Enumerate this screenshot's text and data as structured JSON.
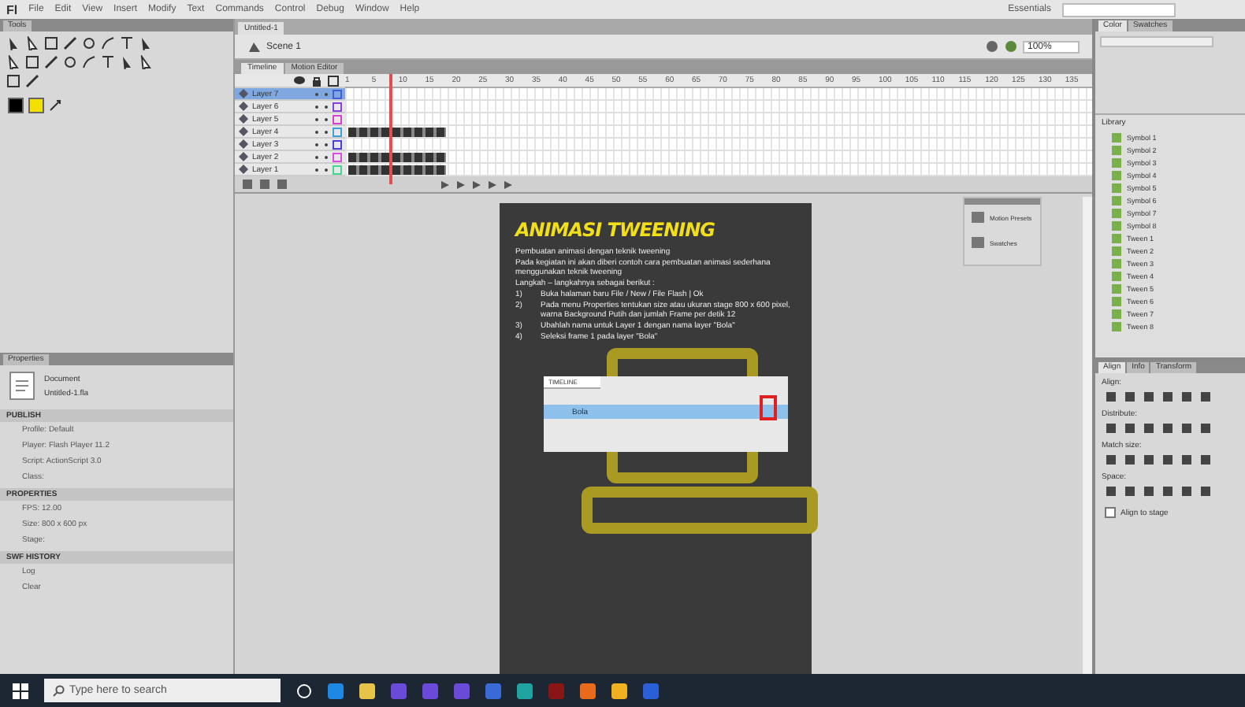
{
  "app": {
    "logo": "Fl",
    "menu": [
      "File",
      "Edit",
      "View",
      "Insert",
      "Modify",
      "Text",
      "Commands",
      "Control",
      "Debug",
      "Window",
      "Help"
    ],
    "workspace": "Essentials"
  },
  "tools_panel": {
    "title": "Tools"
  },
  "document": {
    "tab": "Untitled-1",
    "scene": "Scene 1",
    "zoom": "100%"
  },
  "timeline": {
    "tabs": [
      {
        "label": "Timeline",
        "selected": true
      },
      {
        "label": "Motion Editor",
        "selected": false
      }
    ],
    "frame_numbers": [
      "1",
      "5",
      "10",
      "15",
      "20",
      "25",
      "30",
      "35",
      "40",
      "45",
      "50",
      "55",
      "60",
      "65",
      "70",
      "75",
      "80",
      "85",
      "90",
      "95",
      "100",
      "105",
      "110",
      "115",
      "120",
      "125",
      "130",
      "135"
    ],
    "layers": [
      {
        "name": "Layer 7",
        "selected": true,
        "tween": false,
        "color": "#3f5fd8"
      },
      {
        "name": "Layer 6",
        "selected": false,
        "tween": false,
        "color": "#8a3fd8"
      },
      {
        "name": "Layer 5",
        "selected": false,
        "tween": false,
        "color": "#d83fd0"
      },
      {
        "name": "Layer 4",
        "selected": false,
        "tween": true,
        "color": "#3fa0d8"
      },
      {
        "name": "Layer 3",
        "selected": false,
        "tween": false,
        "color": "#4a3fd8"
      },
      {
        "name": "Layer 2",
        "selected": false,
        "tween": true,
        "color": "#d84fe0"
      },
      {
        "name": "Layer 1",
        "selected": false,
        "tween": true,
        "color": "#3fd88a"
      }
    ]
  },
  "stage": {
    "title": "ANIMASI TWEENING",
    "lines": [
      "Pembuatan animasi dengan teknik tweening",
      "Pada kegiatan ini akan diberi contoh cara pembuatan animasi sederhana menggunakan teknik tweening",
      "Langkah – langkahnya sebagai berikut :"
    ],
    "steps": [
      {
        "number": "1)",
        "text": "Buka halaman baru File / New / File Flash | Ok"
      },
      {
        "number": "2)",
        "text": "Pada menu Properties tentukan size atau ukuran stage 800 x 600 pixel, warna Background Putih dan jumlah Frame per detik 12"
      },
      {
        "number": "3)",
        "text": "Ubahlah nama untuk Layer 1 dengan nama layer \"Bola\""
      },
      {
        "number": "4)",
        "text": "Seleksi frame 1 pada layer \"Bola\""
      }
    ],
    "inset": {
      "tab": "TIMELINE",
      "layer": "Bola"
    }
  },
  "float_panel": {
    "items": [
      "Motion Presets",
      "Swatches"
    ]
  },
  "properties": {
    "tab": "Properties",
    "type": "Document",
    "file": "Untitled-1.fla",
    "sections": [
      {
        "title": "PUBLISH",
        "rows": [
          "Profile: Default",
          "Player: Flash Player 11.2",
          "Script: ActionScript 3.0",
          "Class:"
        ]
      },
      {
        "title": "PROPERTIES",
        "rows": [
          "FPS: 12.00",
          "Size: 800 x 600 px",
          "Stage:"
        ]
      },
      {
        "title": "SWF HISTORY",
        "rows": [
          "Log",
          "Clear"
        ]
      }
    ]
  },
  "color_panel": {
    "tabs": [
      {
        "label": "Color",
        "selected": true
      },
      {
        "label": "Swatches",
        "selected": false
      }
    ]
  },
  "library": {
    "label": "Library",
    "items": [
      "Symbol 1",
      "Symbol 2",
      "Symbol 3",
      "Symbol 4",
      "Symbol 5",
      "Symbol 6",
      "Symbol 7",
      "Symbol 8",
      "Tween 1",
      "Tween 2",
      "Tween 3",
      "Tween 4",
      "Tween 5",
      "Tween 6",
      "Tween 7",
      "Tween 8"
    ]
  },
  "align_panel": {
    "tabs": [
      {
        "label": "Align",
        "selected": true
      },
      {
        "label": "Info",
        "selected": false
      },
      {
        "label": "Transform",
        "selected": false
      }
    ],
    "groups": [
      "Align:",
      "Distribute:",
      "Match size:",
      "Space:"
    ],
    "align_to_stage": {
      "label": "Align to stage",
      "checked": false
    }
  },
  "taskbar": {
    "search_placeholder": "Type here to search",
    "apps": [
      {
        "color": "#1e88e5"
      },
      {
        "color": "#e8c34a"
      },
      {
        "color": "#6a4ad8"
      },
      {
        "color": "#6a4ad8"
      },
      {
        "color": "#6a4ad8"
      },
      {
        "color": "#3a6ad8"
      },
      {
        "color": "#1fa3a0"
      },
      {
        "color": "#8a1515"
      },
      {
        "color": "#e86a1a"
      },
      {
        "color": "#f0b020"
      },
      {
        "color": "#2b5fd8"
      }
    ]
  }
}
